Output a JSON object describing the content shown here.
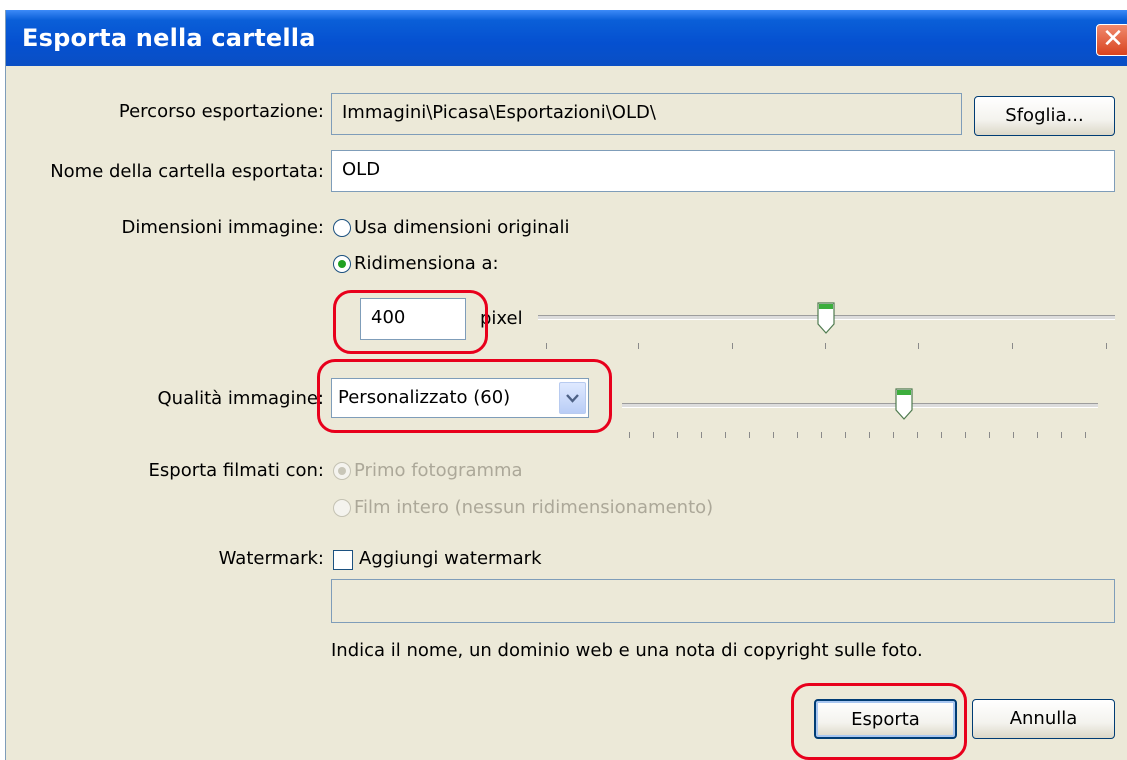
{
  "dialog": {
    "title": "Esporta nella cartella",
    "close_symbol": "✕"
  },
  "export_path": {
    "label": "Percorso esportazione:",
    "value": "Immagini\\Picasa\\Esportazioni\\OLD\\",
    "browse_label": "Sfoglia..."
  },
  "folder_name": {
    "label": "Nome della cartella esportata:",
    "value": "OLD"
  },
  "image_size": {
    "label": "Dimensioni immagine:",
    "option_original": "Usa dimensioni originali",
    "option_resize": "Ridimensiona a:",
    "selected": "resize",
    "pixel_value": "400",
    "pixel_unit": "pixel",
    "slider_fraction": 0.5
  },
  "image_quality": {
    "label": "Qualità immagine:",
    "value": "Personalizzato (60)",
    "slider_fraction": 0.6
  },
  "export_movies": {
    "label": "Esporta filmati con:",
    "option_first_frame": "Primo fotogramma",
    "option_full_movie": "Film intero (nessun ridimensionamento)",
    "selected": "first_frame",
    "disabled": true
  },
  "watermark": {
    "label": "Watermark:",
    "checkbox_label": "Aggiungi watermark",
    "checked": false,
    "text_value": "",
    "hint": "Indica il nome, un dominio web e una nota di copyright sulle foto."
  },
  "buttons": {
    "export_label": "Esporta",
    "cancel_label": "Annulla"
  },
  "colors": {
    "titlebar": "#0550d0",
    "dialog_bg": "#ece9d8",
    "highlight": "#e8001c",
    "radio_dot": "#21a121",
    "slider_thumb": "#3cae3c"
  }
}
